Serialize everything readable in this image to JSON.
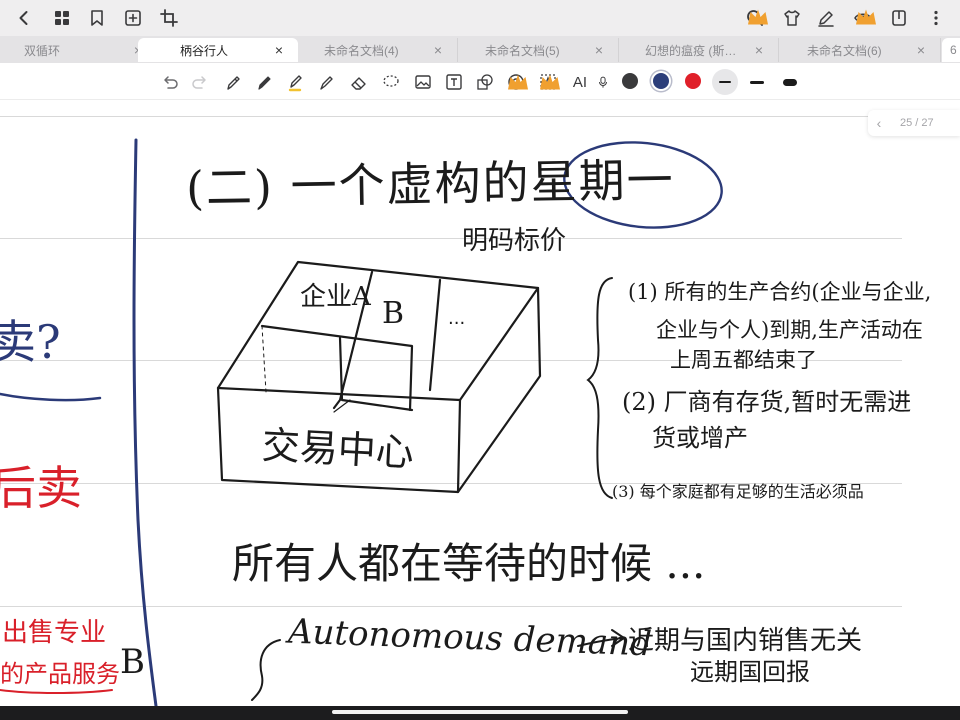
{
  "toolbar": {
    "icons": [
      "back-icon",
      "grid-icon",
      "bookmark-icon",
      "add-page-icon",
      "crop-icon",
      "search-icon",
      "shirt-icon",
      "pen-mode-icon",
      "eye-icon",
      "note-icon",
      "more-icon"
    ]
  },
  "tabs": [
    {
      "label": "双循环",
      "active": false
    },
    {
      "label": "柄谷行人",
      "active": true
    },
    {
      "label": "未命名文档(4)",
      "active": false
    },
    {
      "label": "未命名文档(5)",
      "active": false
    },
    {
      "label": "幻想的瘟疫 (斯…",
      "active": false
    },
    {
      "label": "未命名文档(6)",
      "active": false
    },
    {
      "label": "6",
      "active": false
    }
  ],
  "tab_close_glyph": "×",
  "drawing_tools": {
    "ai_label": "AI",
    "colors": [
      "#3a3a3c",
      "#2c3e7a",
      "#e0202a"
    ],
    "selected_color": "#2c3e7a"
  },
  "page_nav": {
    "prev": "‹",
    "current": 25,
    "total": 27,
    "text": "25 / 27"
  },
  "note": {
    "title": "(二) 一个虚构的星期一",
    "subtitle": "明码标价",
    "left_margin_texts": [
      "卖?",
      "后卖",
      "出售专业",
      "的产品服务",
      "B"
    ],
    "diagram_labels": [
      "企业A",
      "B",
      "...",
      "交易中心"
    ],
    "points": [
      "(1) 所有的生产合约(企业与企业,",
      "企业与个人)到期,生产活动在",
      "上周五都结束了",
      "(2) 厂商有存货,暂时无需进",
      "货或增产",
      "(3) 每个家庭都有足够的生活必须品"
    ],
    "statement": "所有人都在等待的时候 ...",
    "autonomous_demand": "Autonomous demand",
    "ad_notes": [
      "近期与国内销售无关",
      "远期国回报"
    ]
  },
  "colors": {
    "ink_black": "#1b1b1b",
    "ink_navy": "#2b3a78",
    "ink_red": "#d9202a",
    "toolbar_bg": "#efeeef",
    "tabbar_bg": "#e4e3e5"
  }
}
